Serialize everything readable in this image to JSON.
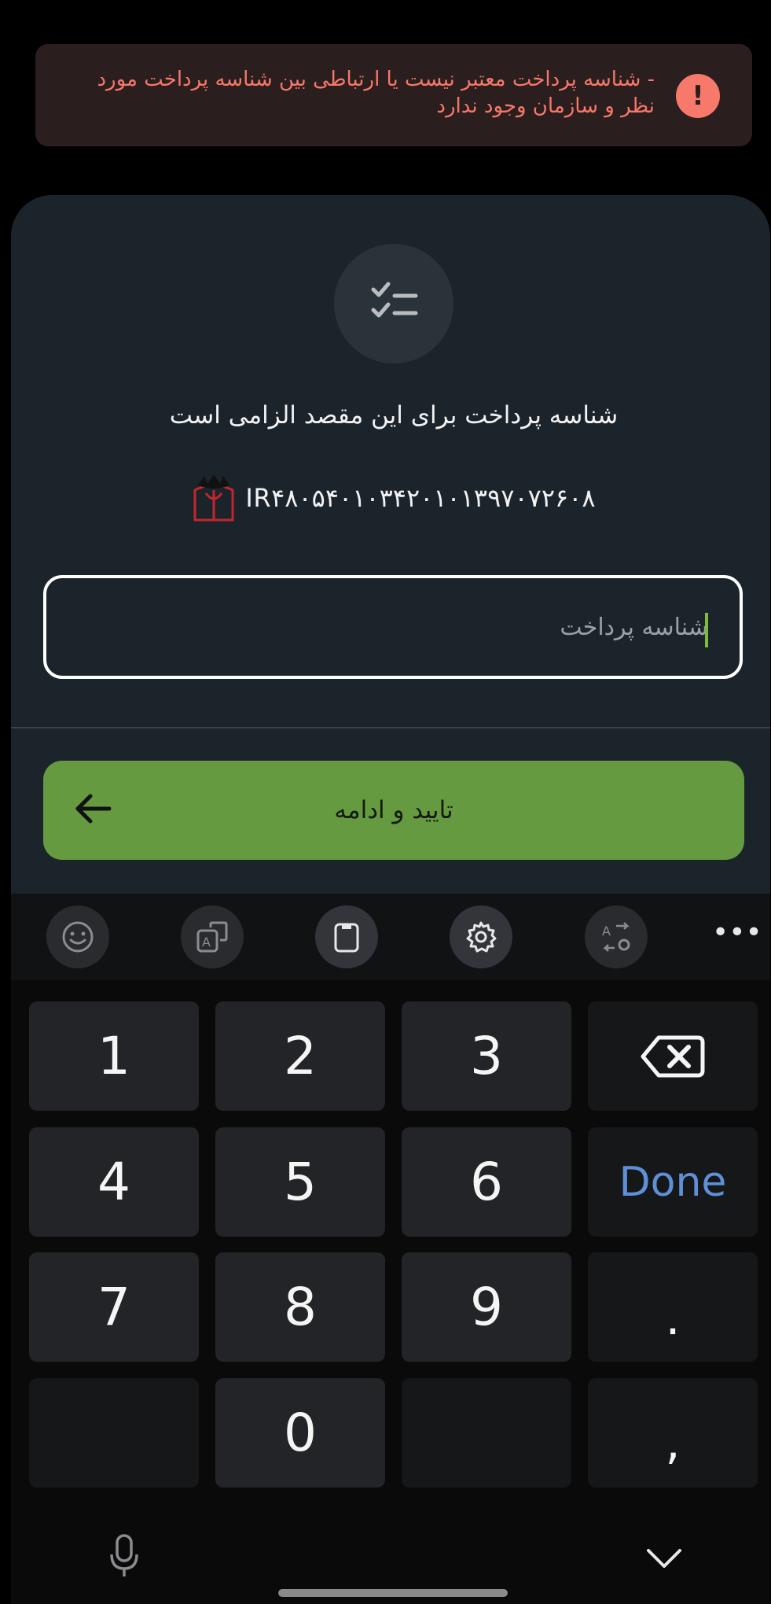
{
  "alert": {
    "icon": "exclamation-icon",
    "message": "- شناسه پرداخت معتبر نیست یا ارتباطی بین شناسه پرداخت مورد نظر و سازمان وجود ندارد",
    "color": "#f8776a"
  },
  "sheet": {
    "icon": "checklist-icon",
    "title": "شناسه پرداخت برای این مقصد الزامی است",
    "iban": "IR۴۸۰۵۴۰۱۰۳۴۲۰۱۰۱۳۹۷۰۷۲۶۰۸",
    "bank_logo": "bank-logo",
    "payment_id_field": {
      "placeholder": "شناسه پرداخت",
      "value": ""
    },
    "confirm_button": {
      "label": "تایید و ادامه",
      "icon": "arrow-left-icon",
      "color": "#659a40"
    }
  },
  "keyboard": {
    "toolbar": [
      "emoji-icon",
      "text-translate-icon",
      "clipboard-icon",
      "settings-icon",
      "language-switch-icon",
      "more-icon"
    ],
    "keys": {
      "k1": "1",
      "k2": "2",
      "k3": "3",
      "k4": "4",
      "k5": "5",
      "k6": "6",
      "done": "Done",
      "k7": "7",
      "k8": "8",
      "k9": "9",
      "dot": ".",
      "k0": "0",
      "comma": ","
    },
    "bottom": [
      "microphone-icon",
      "hide-keyboard-icon"
    ]
  }
}
